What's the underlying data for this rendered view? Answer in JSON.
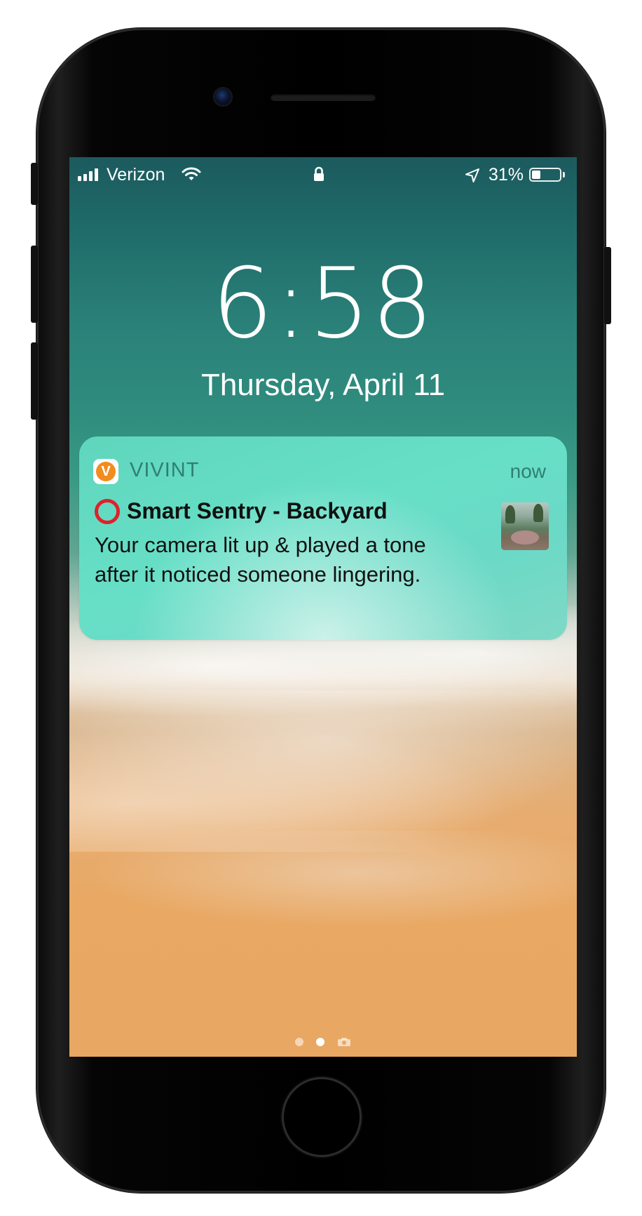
{
  "status_bar": {
    "carrier": "Verizon",
    "battery_percent_label": "31%",
    "battery_level": 0.31,
    "signal_bars": 4,
    "icons": [
      "signal-bars-icon",
      "wifi-icon",
      "lock-icon",
      "location-arrow-icon",
      "battery-icon"
    ]
  },
  "lock_screen": {
    "time": "6:58",
    "date": "Thursday, April 11"
  },
  "notification": {
    "app_name": "VIVINT",
    "app_icon_letter": "V",
    "time": "now",
    "title": "Smart Sentry - Backyard",
    "body": "Your camera lit up & played a tone after it noticed someone lingering.",
    "title_icon": "red-circle-icon",
    "thumbnail": "camera-snapshot-thumbnail"
  },
  "page_indicator": {
    "pages": 3,
    "active_index": 1,
    "last_page_icon": "camera-icon"
  },
  "colors": {
    "accent_app": "#f28c1e",
    "notification_text_accent": "#2f7f72",
    "title_circle": "#e0202a"
  }
}
